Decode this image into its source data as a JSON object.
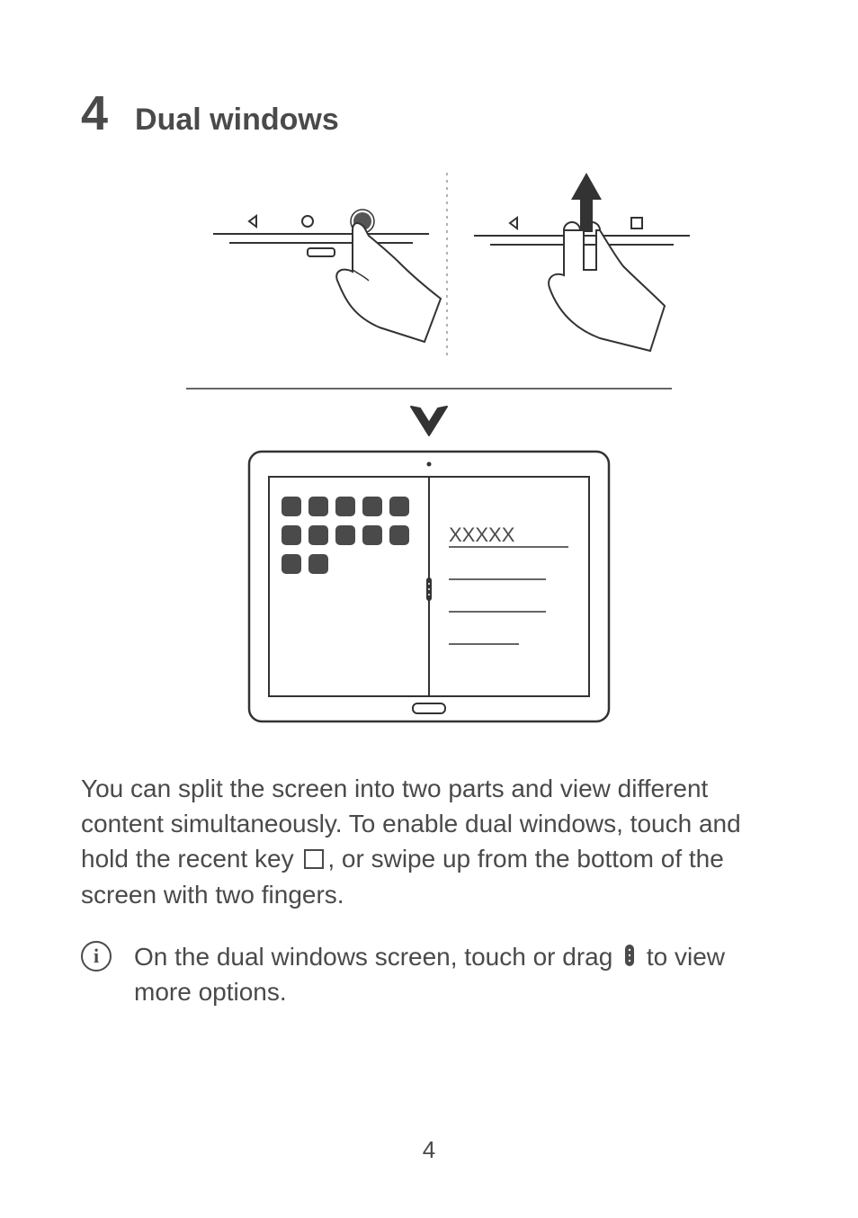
{
  "section": {
    "number": "4",
    "title": "Dual windows"
  },
  "body": {
    "part1": "You can split the screen into two parts and view different content simultaneously. To enable dual windows, touch and hold the recent key ",
    "part2": ", or swipe up from the bottom of the screen with two fingers."
  },
  "note": {
    "part1": "On the dual windows screen, touch or drag ",
    "part2": " to view more options."
  },
  "illustration_placeholder": "XXXXX",
  "page_number": "4"
}
